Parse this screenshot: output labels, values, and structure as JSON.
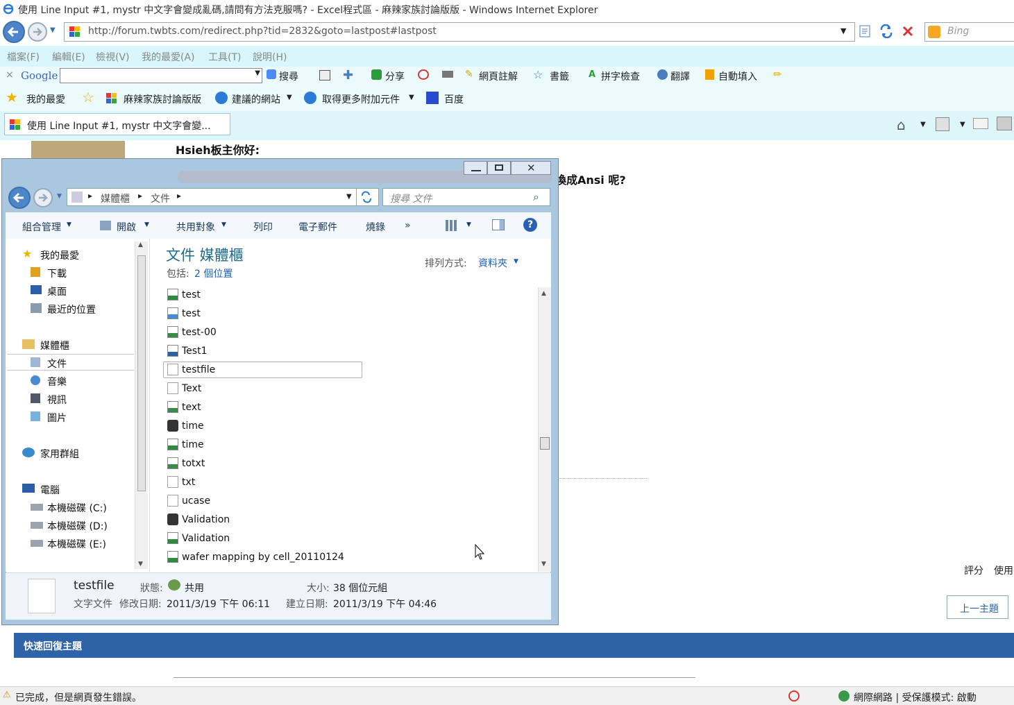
{
  "browser": {
    "title": "使用 Line Input #1, mystr 中文字會變成亂碼,請問有方法克服嗎? - Excel程式區 - 麻辣家族討論版版 - Windows Internet Explorer",
    "url": "http://forum.twbts.com/redirect.php?tid=2832&goto=lastpost#lastpost",
    "search_placeholder": "Bing",
    "menu": [
      "檔案(F)",
      "編輯(E)",
      "檢視(V)",
      "我的最愛(A)",
      "工具(T)",
      "說明(H)"
    ],
    "google_toolbar": {
      "logo": "Google",
      "items": [
        "搜尋",
        "分享",
        "網頁註解",
        "書籤",
        "拼字檢查",
        "翻譯",
        "自動填入"
      ]
    },
    "favorites_bar": {
      "favorites_label": "我的最愛",
      "items": [
        "麻辣家族討論版版",
        "建議的網站",
        "取得更多附加元件",
        "百度"
      ]
    },
    "tab_label": "使用 Line Input #1, mystr 中文字會變...",
    "status_text": "已完成，但是網頁發生錯誤。",
    "zone_text": "網際網路 | 受保護模式: 啟動"
  },
  "page": {
    "greeting": "Hsieh板主你好:",
    "question_tail": "換成Ansi 呢?",
    "rating_label": "評分",
    "use_label": "使用",
    "prev_topic": "上一主題",
    "quick_reply": "快速回復主題"
  },
  "explorer": {
    "breadcrumb": [
      "媒體櫃",
      "文件"
    ],
    "search_placeholder": "搜尋 文件",
    "commands": [
      "組合管理",
      "開啟",
      "共用對象",
      "列印",
      "電子郵件",
      "燒錄",
      "»"
    ],
    "nav": {
      "favorites": "我的最愛",
      "favorites_items": [
        "下載",
        "桌面",
        "最近的位置"
      ],
      "libraries": "媒體櫃",
      "libraries_items": [
        "文件",
        "音樂",
        "視訊",
        "圖片"
      ],
      "homegroup": "家用群組",
      "computer": "電腦",
      "computer_items": [
        "本機磁碟 (C:)",
        "本機磁碟 (D:)",
        "本機磁碟 (E:)"
      ]
    },
    "library_title": "文件 媒體櫃",
    "includes_label": "包括:",
    "includes_link": "2 個位置",
    "arrange_label": "排列方式:",
    "arrange_value": "資料夾",
    "files": [
      {
        "name": "test",
        "type": "excel"
      },
      {
        "name": "test",
        "type": "image"
      },
      {
        "name": "test-00",
        "type": "script"
      },
      {
        "name": "Test1",
        "type": "word"
      },
      {
        "name": "testfile",
        "type": "text",
        "selected": true
      },
      {
        "name": "Text",
        "type": "text"
      },
      {
        "name": "text",
        "type": "script"
      },
      {
        "name": "time",
        "type": "exe"
      },
      {
        "name": "time",
        "type": "excel"
      },
      {
        "name": "totxt",
        "type": "script"
      },
      {
        "name": "txt",
        "type": "text"
      },
      {
        "name": "ucase",
        "type": "text"
      },
      {
        "name": "Validation",
        "type": "exe"
      },
      {
        "name": "Validation",
        "type": "excel"
      },
      {
        "name": "wafer mapping by cell_20110124",
        "type": "excel"
      }
    ],
    "details": {
      "name": "testfile",
      "type": "文字文件",
      "status_label": "狀態:",
      "status_value": "共用",
      "size_label": "大小:",
      "size_value": "38 個位元組",
      "modified_label": "修改日期:",
      "modified_value": "2011/3/19 下午 06:11",
      "created_label": "建立日期:",
      "created_value": "2011/3/19 下午 04:46"
    }
  }
}
